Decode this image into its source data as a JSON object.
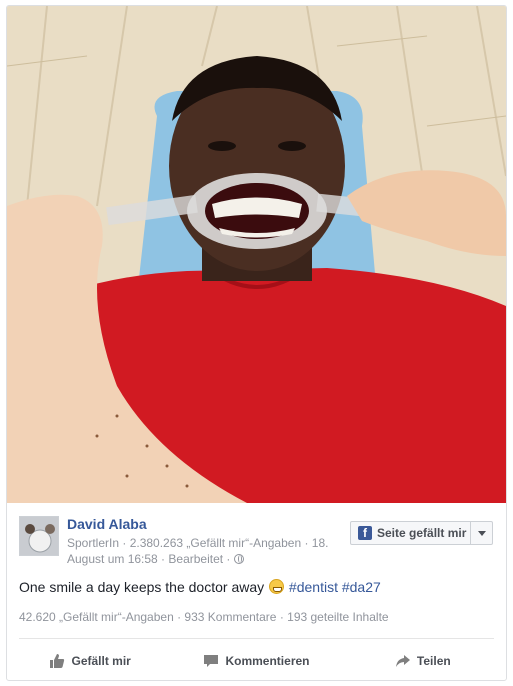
{
  "post": {
    "page_name": "David Alaba",
    "meta_line": "SportlerIn · 2.380.263 „Gefällt mir“-Angaben · 18. August um 16:58 · Bearbeitet ·",
    "like_page_button": "Seite gefällt mir",
    "caption_text": "One smile a day keeps the doctor away",
    "hashtags": [
      "#dentist",
      "#da27"
    ],
    "stats": {
      "likes": "42.620 „Gefällt mir“-Angaben",
      "comments": "933 Kommentare",
      "shares": "193 geteilte Inhalte"
    },
    "actions": {
      "like": "Gefällt mir",
      "comment": "Kommentieren",
      "share": "Teilen"
    }
  },
  "icons": {
    "brand": "facebook-icon",
    "privacy": "globe-icon",
    "like": "thumbs-up-icon",
    "comment": "comment-bubble-icon",
    "share": "share-arrow-icon",
    "emoji": "grinning-face-icon"
  },
  "colors": {
    "link": "#365899",
    "brand": "#3b5998",
    "meta": "#90949c",
    "shirt": "#d11a22"
  }
}
